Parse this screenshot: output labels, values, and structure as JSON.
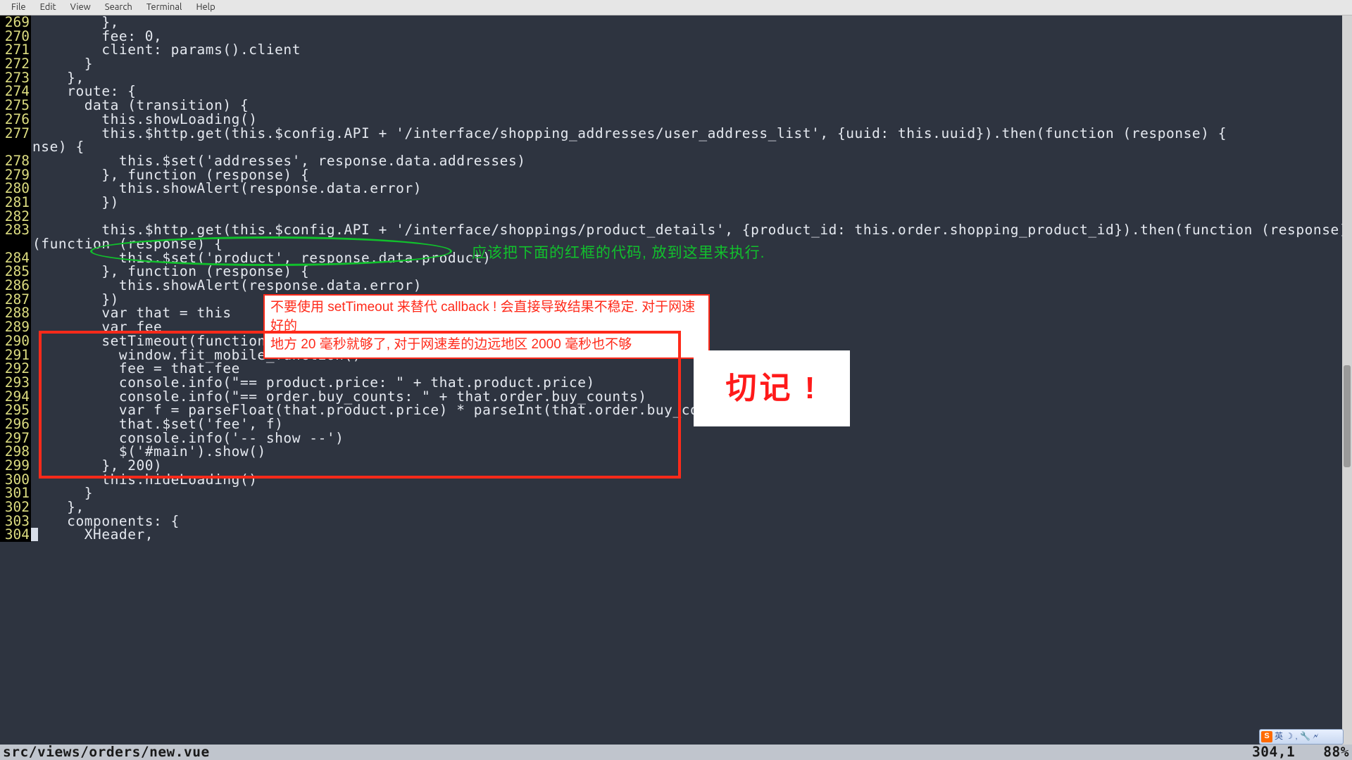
{
  "menubar": {
    "items": [
      "File",
      "Edit",
      "View",
      "Search",
      "Terminal",
      "Help"
    ]
  },
  "statusbar": {
    "file": "src/views/orders/new.vue",
    "position": "304,1",
    "scroll": "88%"
  },
  "annotations": {
    "green_text": "应该把下面的红框的代码, 放到这里来执行.",
    "white_note_line1": "不要使用 setTimeout 来替代 callback ! 会直接导致结果不稳定. 对于网速好的",
    "white_note_line2": "地方 20 毫秒就够了, 对于网速差的边远地区 2000 毫秒也不够",
    "big_note": "切记 !"
  },
  "ime": {
    "logo": "S",
    "label": "英 ☽ , 🔧 🗲"
  },
  "code_lines": [
    {
      "n": 269,
      "t": "        },"
    },
    {
      "n": 270,
      "t": "        fee: 0,"
    },
    {
      "n": 271,
      "t": "        client: params().client"
    },
    {
      "n": 272,
      "t": "      }"
    },
    {
      "n": 273,
      "t": "    },"
    },
    {
      "n": 274,
      "t": "    route: {"
    },
    {
      "n": 275,
      "t": "      data (transition) {"
    },
    {
      "n": 276,
      "t": "        this.showLoading()"
    },
    {
      "n": 277,
      "t": "        this.$http.get(this.$config.API + '/interface/shopping_addresses/user_address_list', {uuid: this.uuid}).then(function (response) {"
    },
    {
      "n": 278,
      "t": "          this.$set('addresses', response.data.addresses)"
    },
    {
      "n": 279,
      "t": "        }, function (response) {"
    },
    {
      "n": 280,
      "t": "          this.showAlert(response.data.error)"
    },
    {
      "n": 281,
      "t": "        })"
    },
    {
      "n": 282,
      "t": ""
    },
    {
      "n": 283,
      "t": "        this.$http.get(this.$config.API + '/interface/shoppings/product_details', {product_id: this.order.shopping_product_id}).then(function (response) {"
    },
    {
      "n": 284,
      "t": "          this.$set('product', response.data.product)"
    },
    {
      "n": 285,
      "t": "        }, function (response) {"
    },
    {
      "n": 286,
      "t": "          this.showAlert(response.data.error)"
    },
    {
      "n": 287,
      "t": "        })"
    },
    {
      "n": 288,
      "t": "        var that = this"
    },
    {
      "n": 289,
      "t": "        var fee"
    },
    {
      "n": 290,
      "t": "        setTimeout(function () {"
    },
    {
      "n": 291,
      "t": "          window.fit_mobile_function()"
    },
    {
      "n": 292,
      "t": "          fee = that.fee"
    },
    {
      "n": 293,
      "t": "          console.info(\"== product.price: \" + that.product.price)"
    },
    {
      "n": 294,
      "t": "          console.info(\"== order.buy_counts: \" + that.order.buy_counts)"
    },
    {
      "n": 295,
      "t": "          var f = parseFloat(that.product.price) * parseInt(that.order.buy_counts)"
    },
    {
      "n": 296,
      "t": "          that.$set('fee', f)"
    },
    {
      "n": 297,
      "t": "          console.info('-- show --')"
    },
    {
      "n": 298,
      "t": "          $('#main').show()"
    },
    {
      "n": 299,
      "t": "        }, 200)"
    },
    {
      "n": 300,
      "t": "        this.hideLoading()"
    },
    {
      "n": 301,
      "t": "      }"
    },
    {
      "n": 302,
      "t": "    },"
    },
    {
      "n": 303,
      "t": "    components: {"
    },
    {
      "n": 304,
      "t": "      XHeader,"
    }
  ],
  "wrap_indicator": "nse) {"
}
